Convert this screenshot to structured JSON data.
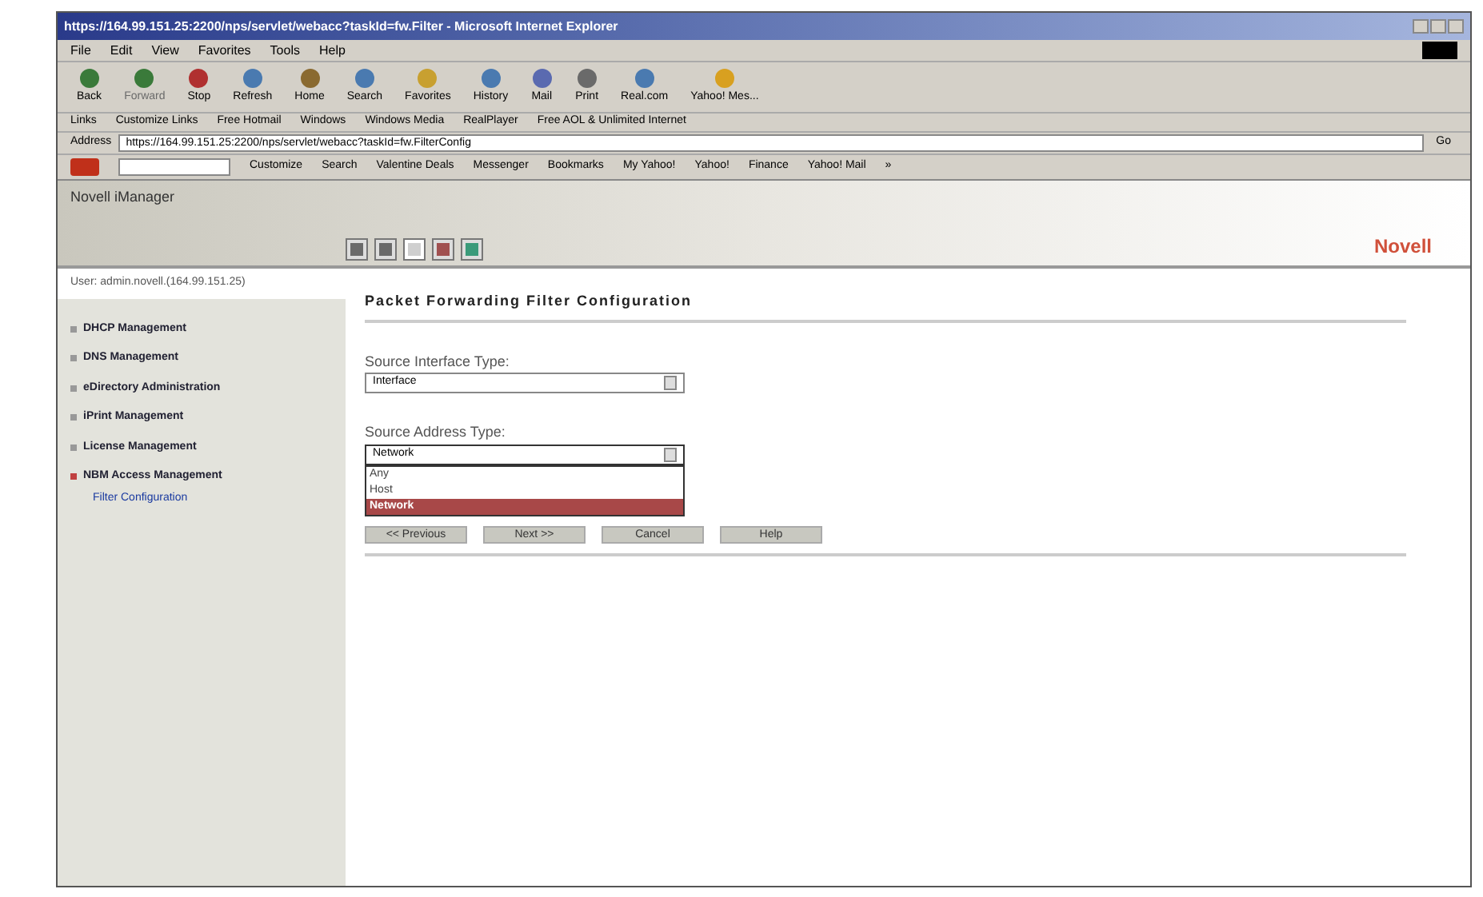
{
  "window": {
    "title": "https://164.99.151.25:2200/nps/servlet/webacc?taskId=fw.Filter - Microsoft Internet Explorer"
  },
  "menu": [
    "File",
    "Edit",
    "View",
    "Favorites",
    "Tools",
    "Help"
  ],
  "toolbar": [
    {
      "label": "Back",
      "disabled": false
    },
    {
      "label": "Forward",
      "disabled": true
    },
    {
      "label": "Stop",
      "disabled": false
    },
    {
      "label": "Refresh",
      "disabled": false
    },
    {
      "label": "Home",
      "disabled": false
    },
    {
      "label": "Search",
      "disabled": false
    },
    {
      "label": "Favorites",
      "disabled": false
    },
    {
      "label": "History",
      "disabled": false
    },
    {
      "label": "Mail",
      "disabled": false
    },
    {
      "label": "Print",
      "disabled": false
    },
    {
      "label": "Real.com",
      "disabled": false
    },
    {
      "label": "Yahoo! Mes...",
      "disabled": false
    }
  ],
  "links_bar": {
    "label": "Links",
    "links": [
      "Customize Links",
      "Free Hotmail",
      "Windows",
      "Windows Media",
      "RealPlayer",
      "Free AOL & Unlimited Internet"
    ]
  },
  "address_bar": {
    "label": "Address",
    "value": "https://164.99.151.25:2200/nps/servlet/webacc?taskId=fw.FilterConfig",
    "go": "Go"
  },
  "yahoo_toolbar": {
    "items": [
      "Customize",
      "Search",
      "Valentine Deals",
      "Messenger",
      "Bookmarks",
      "My Yahoo!",
      "Yahoo!",
      "Finance",
      "Yahoo! Mail",
      "»"
    ]
  },
  "app": {
    "title": "Novell iManager",
    "logo": "Novell",
    "user": "User: admin.novell.(164.99.151.25)"
  },
  "sidebar": {
    "items": [
      {
        "label": "DHCP Management",
        "expanded": false
      },
      {
        "label": "DNS Management",
        "expanded": false
      },
      {
        "label": "eDirectory Administration",
        "expanded": false
      },
      {
        "label": "iPrint Management",
        "expanded": false
      },
      {
        "label": "License Management",
        "expanded": false
      },
      {
        "label": "NBM Access Management",
        "expanded": true,
        "children": [
          {
            "label": "Filter Configuration"
          }
        ]
      }
    ]
  },
  "form": {
    "title": "Packet Forwarding Filter Configuration",
    "fields": [
      {
        "label": "Source Interface Type:",
        "value": "Interface",
        "expanded": false
      },
      {
        "label": "Source Address Type:",
        "value": "Network",
        "expanded": true,
        "options": [
          {
            "label": "Any",
            "selected": false
          },
          {
            "label": "Host",
            "selected": false
          },
          {
            "label": "Network",
            "selected": true
          }
        ]
      }
    ],
    "buttons": [
      "<< Previous",
      "Next >>",
      "Cancel",
      "Help"
    ]
  }
}
